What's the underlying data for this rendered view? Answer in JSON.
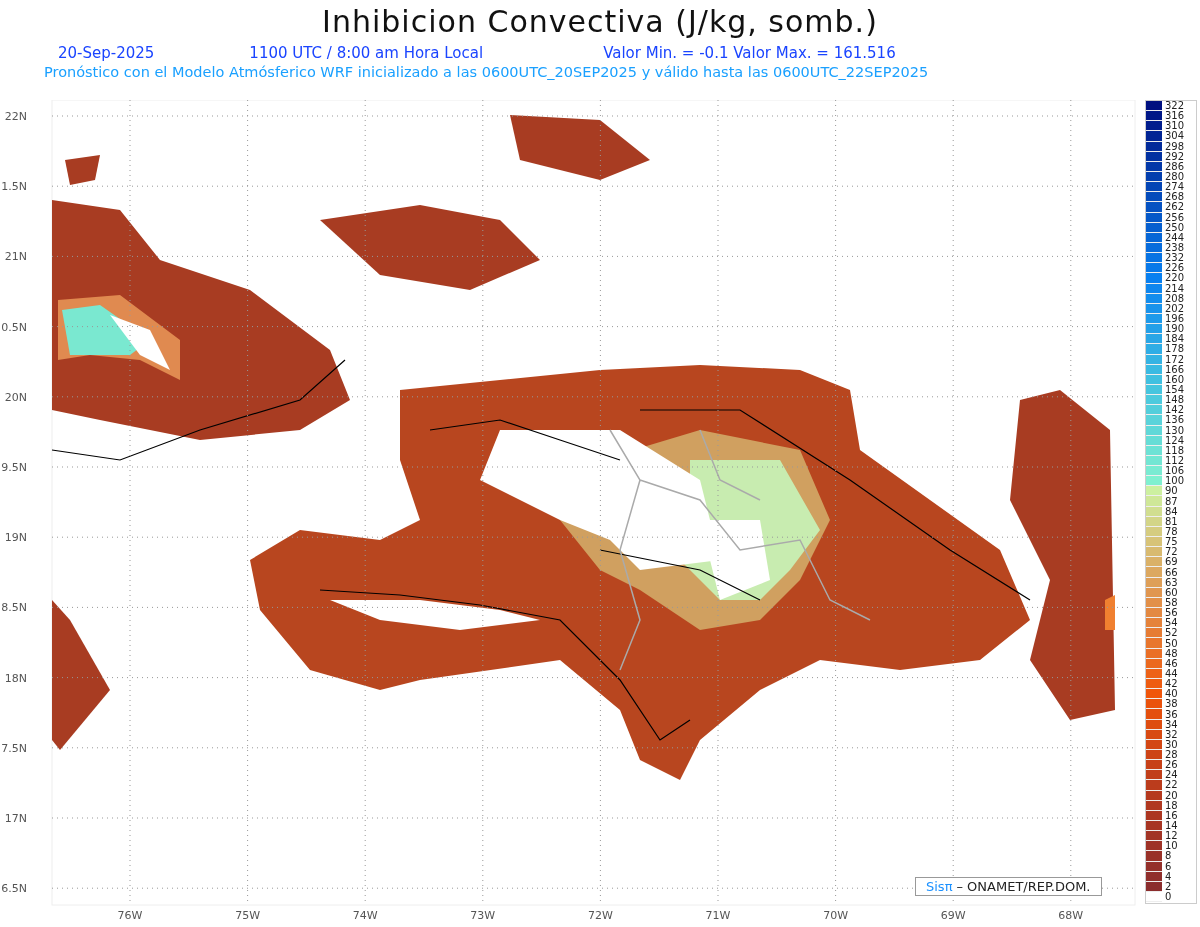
{
  "title": "Inhibicion Convectiva (J/kg, somb.)",
  "date": "20-Sep-2025",
  "time": "1100 UTC / 8:00 am Hora Local",
  "value_range": "Valor Min. = -0.1  Valor Max. = 161.516",
  "subtitle": "Pronóstico con el Modelo Atmósferico WRF inicializado a las 0600UTC_20SEP2025 y válido hasta las  0600UTC_22SEP2025",
  "map": {
    "lat_labels": [
      "22N",
      "1.5N",
      "21N",
      "0.5N",
      "20N",
      "9.5N",
      "19N",
      "8.5N",
      "18N",
      "7.5N",
      "17N",
      "6.5N"
    ],
    "lon_labels": [
      "76W",
      "75W",
      "74W",
      "73W",
      "72W",
      "71W",
      "70W",
      "69W",
      "68W"
    ]
  },
  "legend": [
    "322",
    "316",
    "310",
    "304",
    "298",
    "292",
    "286",
    "280",
    "274",
    "268",
    "262",
    "256",
    "250",
    "244",
    "238",
    "232",
    "226",
    "220",
    "214",
    "208",
    "202",
    "196",
    "190",
    "184",
    "178",
    "172",
    "166",
    "160",
    "154",
    "148",
    "142",
    "136",
    "130",
    "124",
    "118",
    "112",
    "106",
    "100",
    "90",
    "87",
    "84",
    "81",
    "78",
    "75",
    "72",
    "69",
    "66",
    "63",
    "60",
    "58",
    "56",
    "54",
    "52",
    "50",
    "48",
    "46",
    "44",
    "42",
    "40",
    "38",
    "36",
    "34",
    "32",
    "30",
    "28",
    "26",
    "24",
    "22",
    "20",
    "18",
    "16",
    "14",
    "12",
    "10",
    "8",
    "6",
    "4",
    "2",
    "0"
  ],
  "credit": {
    "logo": "Sisπ",
    "text": "– ONAMET/REP.DOM."
  }
}
